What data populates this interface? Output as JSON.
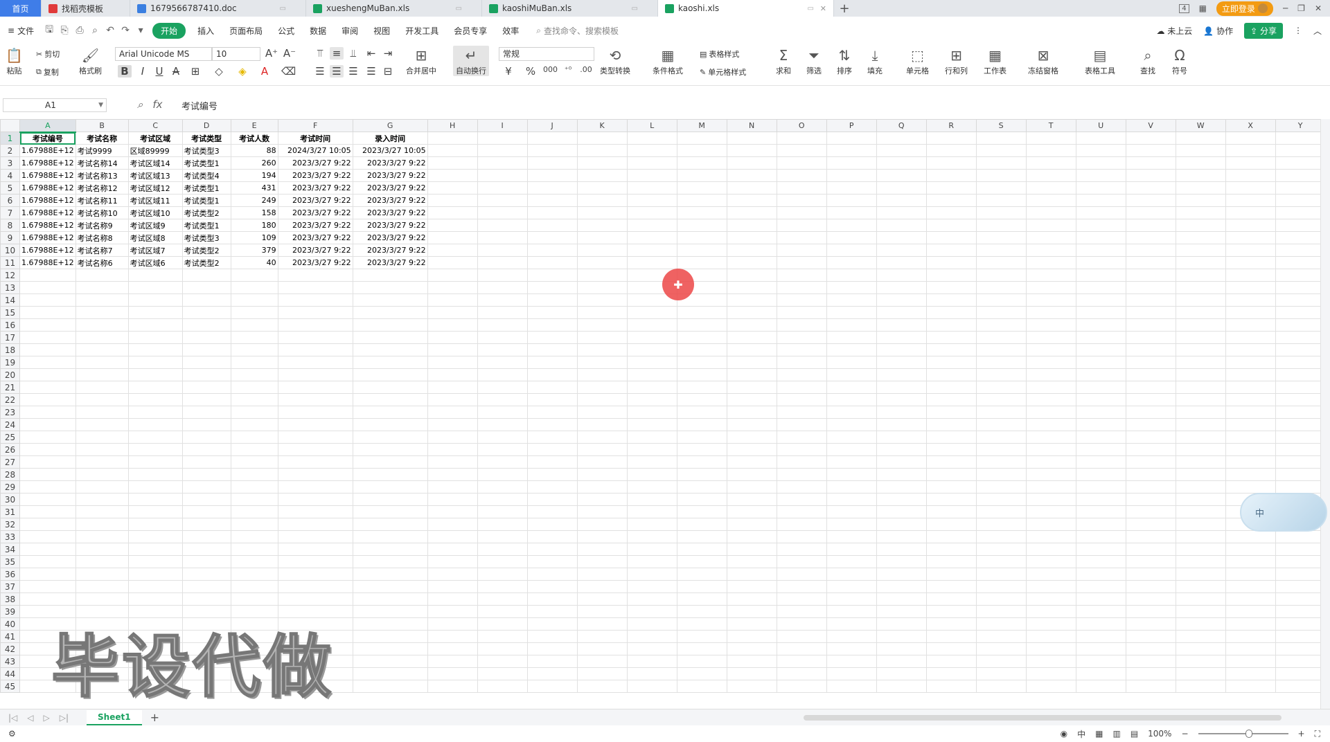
{
  "tabs": {
    "home": "首页",
    "items": [
      {
        "label": "找稻壳模板",
        "color": "#e03a3a"
      },
      {
        "label": "1679566787410.doc",
        "color": "#3b7fe0"
      },
      {
        "label": "xueshengMuBan.xls",
        "color": "#1aa260"
      },
      {
        "label": "kaoshiMuBan.xls",
        "color": "#1aa260"
      },
      {
        "label": "kaoshi.xls",
        "color": "#1aa260"
      }
    ],
    "login": "立即登录",
    "badge": "4"
  },
  "menu": {
    "file": "文件",
    "items": [
      "开始",
      "插入",
      "页面布局",
      "公式",
      "数据",
      "审阅",
      "视图",
      "开发工具",
      "会员专享",
      "效率"
    ],
    "search_placeholder": "查找命令、搜索模板",
    "cloud": "未上云",
    "collab": "协作",
    "share": "分享"
  },
  "ribbon": {
    "paste": "粘贴",
    "cut": "剪切",
    "copy": "复制",
    "format_painter": "格式刷",
    "font_name": "Arial Unicode MS",
    "font_size": "10",
    "merge": "合并居中",
    "wrap": "自动换行",
    "number_format": "常规",
    "type_convert": "类型转换",
    "cond_format": "条件格式",
    "table_style": "表格样式",
    "cell_style": "单元格样式",
    "sum": "求和",
    "filter": "筛选",
    "sort": "排序",
    "fill": "填充",
    "cells": "单元格",
    "rows_cols": "行和列",
    "worksheet": "工作表",
    "freeze": "冻结窗格",
    "table_tools": "表格工具",
    "find": "查找",
    "symbol": "符号"
  },
  "formula": {
    "cell_ref": "A1",
    "content": "考试编号"
  },
  "columns": [
    "A",
    "B",
    "C",
    "D",
    "E",
    "F",
    "G",
    "H",
    "I",
    "J",
    "K",
    "L",
    "M",
    "N",
    "O",
    "P",
    "Q",
    "R",
    "S",
    "T",
    "U",
    "V",
    "W",
    "X",
    "Y"
  ],
  "headers": [
    "考试编号",
    "考试名称",
    "考试区域",
    "考试类型",
    "考试人数",
    "考试时间",
    "录入时间"
  ],
  "rows": [
    [
      "1.67988E+12",
      "考试9999",
      "区域89999",
      "考试类型3",
      "88",
      "2024/3/27 10:05",
      "2023/3/27 10:05"
    ],
    [
      "1.67988E+12",
      "考试名称14",
      "考试区域14",
      "考试类型1",
      "260",
      "2023/3/27 9:22",
      "2023/3/27 9:22"
    ],
    [
      "1.67988E+12",
      "考试名称13",
      "考试区域13",
      "考试类型4",
      "194",
      "2023/3/27 9:22",
      "2023/3/27 9:22"
    ],
    [
      "1.67988E+12",
      "考试名称12",
      "考试区域12",
      "考试类型1",
      "431",
      "2023/3/27 9:22",
      "2023/3/27 9:22"
    ],
    [
      "1.67988E+12",
      "考试名称11",
      "考试区域11",
      "考试类型1",
      "249",
      "2023/3/27 9:22",
      "2023/3/27 9:22"
    ],
    [
      "1.67988E+12",
      "考试名称10",
      "考试区域10",
      "考试类型2",
      "158",
      "2023/3/27 9:22",
      "2023/3/27 9:22"
    ],
    [
      "1.67988E+12",
      "考试名称9",
      "考试区域9",
      "考试类型1",
      "180",
      "2023/3/27 9:22",
      "2023/3/27 9:22"
    ],
    [
      "1.67988E+12",
      "考试名称8",
      "考试区域8",
      "考试类型3",
      "109",
      "2023/3/27 9:22",
      "2023/3/27 9:22"
    ],
    [
      "1.67988E+12",
      "考试名称7",
      "考试区域7",
      "考试类型2",
      "379",
      "2023/3/27 9:22",
      "2023/3/27 9:22"
    ],
    [
      "1.67988E+12",
      "考试名称6",
      "考试区域6",
      "考试类型2",
      "40",
      "2023/3/27 9:22",
      "2023/3/27 9:22"
    ]
  ],
  "total_rows": 45,
  "sheet": {
    "name": "Sheet1"
  },
  "status": {
    "zoom": "100%",
    "ime": "中"
  },
  "watermark": "毕设代做",
  "ime_float": "中"
}
